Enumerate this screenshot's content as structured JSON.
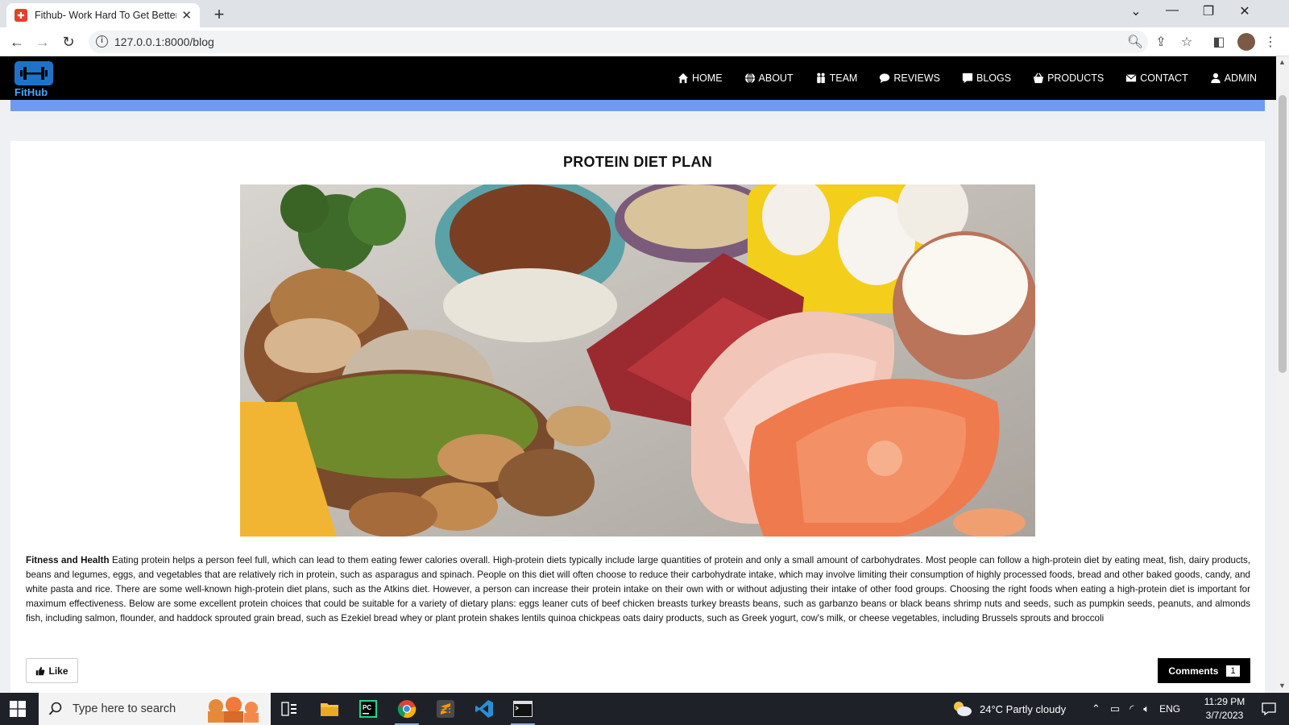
{
  "browser": {
    "tab_title": "Fithub- Work Hard To Get Better",
    "url": "127.0.0.1:8000/blog"
  },
  "site": {
    "logo_text": "FitHub",
    "nav": [
      {
        "label": "HOME",
        "icon": "home-icon"
      },
      {
        "label": "ABOUT",
        "icon": "globe-icon"
      },
      {
        "label": "TEAM",
        "icon": "team-icon"
      },
      {
        "label": "REVIEWS",
        "icon": "comment-icon"
      },
      {
        "label": "BLOGS",
        "icon": "blog-icon"
      },
      {
        "label": "PRODUCTS",
        "icon": "basket-icon"
      },
      {
        "label": "CONTACT",
        "icon": "envelope-icon"
      },
      {
        "label": "ADMIN",
        "icon": "user-icon"
      }
    ],
    "accent_color": "#6e9af0"
  },
  "post": {
    "title": "PROTEIN DIET PLAN",
    "category": "Fitness and Health",
    "body": "Eating protein helps a person feel full, which can lead to them eating fewer calories overall. High-protein diets typically include large quantities of protein and only a small amount of carbohydrates. Most people can follow a high-protein diet by eating meat, fish, dairy products, beans and legumes, eggs, and vegetables that are relatively rich in protein, such as asparagus and spinach. People on this diet will often choose to reduce their carbohydrate intake, which may involve limiting their consumption of highly processed foods, bread and other baked goods, candy, and white pasta and rice. There are some well-known high-protein diet plans, such as the Atkins diet. However, a person can increase their protein intake on their own with or without adjusting their intake of other food groups. Choosing the right foods when eating a high-protein diet is important for maximum effectiveness. Below are some excellent protein choices that could be suitable for a variety of dietary plans: eggs leaner cuts of beef chicken breasts turkey breasts beans, such as garbanzo beans or black beans shrimp nuts and seeds, such as pumpkin seeds, peanuts, and almonds fish, including salmon, flounder, and haddock sprouted grain bread, such as Ezekiel bread whey or plant protein shakes lentils quinoa chickpeas oats dairy products, such as Greek yogurt, cow's milk, or cheese vegetables, including Brussels sprouts and broccoli",
    "like_label": "Like",
    "comments_label": "Comments",
    "comments_count": "1"
  },
  "taskbar": {
    "search_placeholder": "Type here to search",
    "weather": "24°C  Partly cloudy",
    "language": "ENG",
    "time": "11:29 PM",
    "date": "3/7/2023"
  }
}
